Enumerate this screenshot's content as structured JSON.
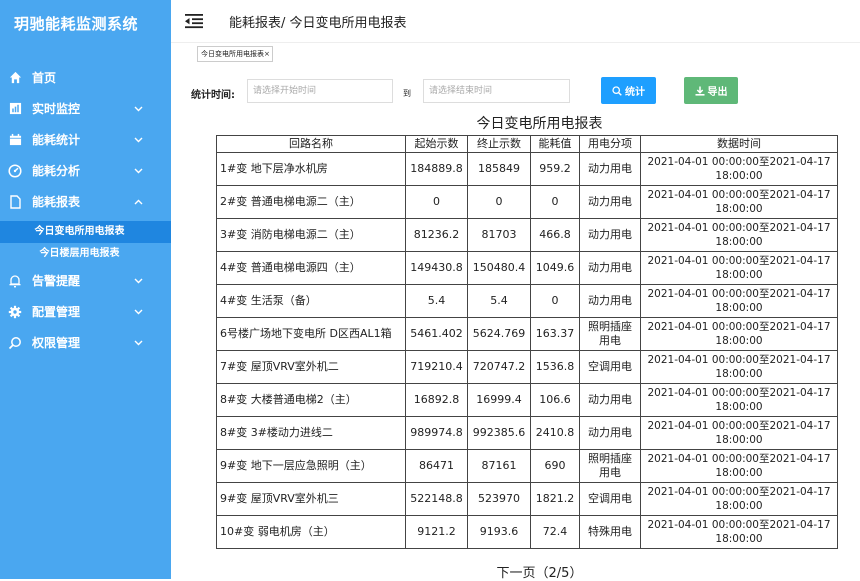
{
  "app": {
    "title": "玥驰能耗监测系统"
  },
  "sidebar": {
    "items": [
      {
        "label": "首页",
        "icon": "home-icon"
      },
      {
        "label": "实时监控",
        "icon": "bar-chart-icon"
      },
      {
        "label": "能耗统计",
        "icon": "calendar-icon"
      },
      {
        "label": "能耗分析",
        "icon": "gauge-icon"
      },
      {
        "label": "能耗报表",
        "icon": "document-icon"
      },
      {
        "label": "告警提醒",
        "icon": "bell-icon"
      },
      {
        "label": "配置管理",
        "icon": "gear-icon"
      },
      {
        "label": "权限管理",
        "icon": "search-icon"
      }
    ],
    "sub_items": [
      {
        "label": "今日变电所用电报表"
      },
      {
        "label": "今日楼层用电报表"
      }
    ]
  },
  "header": {
    "breadcrumb": "能耗报表/ 今日变电所用电报表"
  },
  "tabs": [
    {
      "label": "今日变电所用电报表",
      "close": "×"
    }
  ],
  "filter": {
    "label": "统计时间:",
    "start_placeholder": "请选择开始时间",
    "separator": "到",
    "end_placeholder": "请选择结束时间",
    "stat_button": "统计",
    "export_button": "导出"
  },
  "report": {
    "title": "今日变电所用电报表",
    "columns": [
      "回路名称",
      "起始示数",
      "终止示数",
      "能耗值",
      "用电分项",
      "数据时间"
    ],
    "rows": [
      [
        "1#变 地下层净水机房",
        "184889.8",
        "185849",
        "959.2",
        "动力用电",
        "2021-04-01 00:00:00至2021-04-17 18:00:00"
      ],
      [
        "2#变 普通电梯电源二（主）",
        "0",
        "0",
        "0",
        "动力用电",
        "2021-04-01 00:00:00至2021-04-17 18:00:00"
      ],
      [
        "3#变 消防电梯电源二（主）",
        "81236.2",
        "81703",
        "466.8",
        "动力用电",
        "2021-04-01 00:00:00至2021-04-17 18:00:00"
      ],
      [
        "4#变 普通电梯电源四（主）",
        "149430.8",
        "150480.4",
        "1049.6",
        "动力用电",
        "2021-04-01 00:00:00至2021-04-17 18:00:00"
      ],
      [
        "4#变 生活泵（备）",
        "5.4",
        "5.4",
        "0",
        "动力用电",
        "2021-04-01 00:00:00至2021-04-17 18:00:00"
      ],
      [
        "6号楼广场地下变电所 D区西AL1箱",
        "5461.402",
        "5624.769",
        "163.37",
        "照明插座用电",
        "2021-04-01 00:00:00至2021-04-17 18:00:00"
      ],
      [
        "7#变 屋顶VRV室外机二",
        "719210.4",
        "720747.2",
        "1536.8",
        "空调用电",
        "2021-04-01 00:00:00至2021-04-17 18:00:00"
      ],
      [
        "8#变 大楼普通电梯2（主）",
        "16892.8",
        "16999.4",
        "106.6",
        "动力用电",
        "2021-04-01 00:00:00至2021-04-17 18:00:00"
      ],
      [
        "8#变 3#楼动力进线二",
        "989974.8",
        "992385.6",
        "2410.8",
        "动力用电",
        "2021-04-01 00:00:00至2021-04-17 18:00:00"
      ],
      [
        "9#变 地下一层应急照明（主）",
        "86471",
        "87161",
        "690",
        "照明插座用电",
        "2021-04-01 00:00:00至2021-04-17 18:00:00"
      ],
      [
        "9#变 屋顶VRV室外机三",
        "522148.8",
        "523970",
        "1821.2",
        "空调用电",
        "2021-04-01 00:00:00至2021-04-17 18:00:00"
      ],
      [
        "10#变 弱电机房（主）",
        "9121.2",
        "9193.6",
        "72.4",
        "特殊用电",
        "2021-04-01 00:00:00至2021-04-17 18:00:00"
      ]
    ]
  },
  "pager": {
    "label": "下一页（2/5）"
  },
  "colors": {
    "sidebar": "#4aa7f0",
    "active": "#1f86e0",
    "stat": "#1e9fff",
    "export": "#5fb878"
  }
}
